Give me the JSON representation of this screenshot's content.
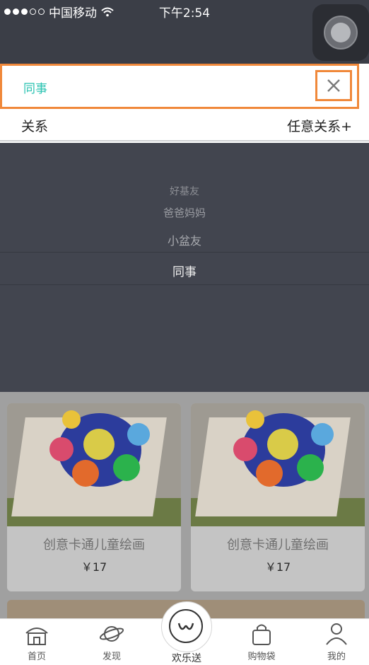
{
  "status": {
    "carrier": "中国移动",
    "time": "下午2:54"
  },
  "selection": {
    "selected": "同事"
  },
  "relation_bar": {
    "label": "关系",
    "action": "任意关系+"
  },
  "picker": {
    "options": [
      "",
      "好基友",
      "爸爸妈妈",
      "小盆友"
    ],
    "selected": "同事"
  },
  "products": [
    {
      "name": "创意卡通儿童绘画",
      "price": "￥17"
    },
    {
      "name": "创意卡通儿童绘画",
      "price": "￥17"
    }
  ],
  "tabs": [
    "首页",
    "发现",
    "欢乐送",
    "购物袋",
    "我的"
  ],
  "colors": {
    "accent": "#2bc3b2",
    "highlight": "#f0883a",
    "overlay": "#42454f"
  }
}
